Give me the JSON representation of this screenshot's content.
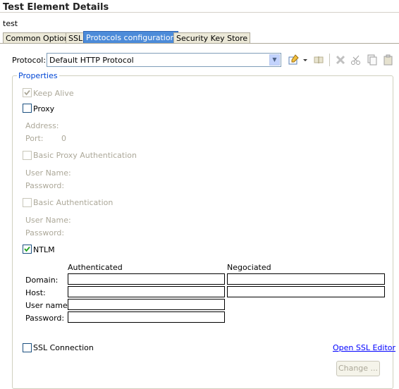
{
  "header": {
    "title": "Test Element Details",
    "subtitle": "test"
  },
  "tabs": [
    {
      "label": "Common Options",
      "active": false
    },
    {
      "label": "SSL",
      "active": false
    },
    {
      "label": "Protocols configuration",
      "active": true
    },
    {
      "label": "Security Key Store",
      "active": false
    }
  ],
  "protocol": {
    "label": "Protocol:",
    "selected": "Default HTTP Protocol"
  },
  "toolbar_icons": [
    "new-protocol-icon",
    "dropdown-arrow-icon",
    "edit-icon",
    "delete-icon",
    "cut-icon",
    "copy-icon",
    "paste-icon"
  ],
  "properties": {
    "title": "Properties",
    "keep_alive": {
      "label": "Keep Alive",
      "checked": true,
      "enabled": false
    },
    "proxy": {
      "label": "Proxy",
      "checked": false,
      "enabled": true
    },
    "proxy_address_label": "Address:",
    "proxy_port_label": "Port:",
    "proxy_port_value": "0",
    "basic_proxy_auth": {
      "label": "Basic Proxy Authentication",
      "checked": false,
      "enabled": false
    },
    "proxy_user_label": "User Name:",
    "proxy_password_label": "Password:",
    "basic_auth": {
      "label": "Basic Authentication",
      "checked": false,
      "enabled": false
    },
    "basic_user_label": "User Name:",
    "basic_password_label": "Password:",
    "ntlm": {
      "label": "NTLM",
      "checked": true,
      "enabled": true
    },
    "ntlm_table": {
      "col_authenticated": "Authenticated",
      "col_negociated": "Negociated",
      "domain_label": "Domain:",
      "host_label": "Host:",
      "username_label": "User name:",
      "password_label": "Password:"
    },
    "ssl_connection": {
      "label": "SSL Connection",
      "checked": false,
      "enabled": true
    },
    "open_ssl_editor": "Open SSL Editor",
    "change_button": "Change ..."
  },
  "colors": {
    "active_tab": "#4c8bd9",
    "group_title": "#0046d5",
    "link": "#0000ff",
    "disabled_text": "#aca899"
  }
}
